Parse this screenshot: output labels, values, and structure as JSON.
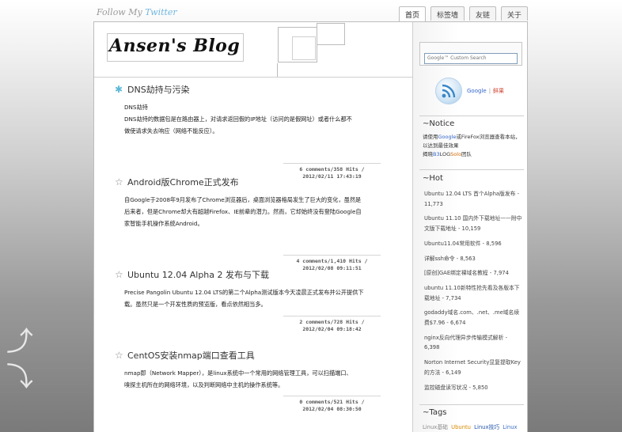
{
  "header": {
    "follow_text": "Follow My",
    "follow_twitter": "Twitter",
    "tabs": [
      "首页",
      "标签墙",
      "友链",
      "关于"
    ]
  },
  "blog": {
    "title": "Ansen's Blog"
  },
  "posts": [
    {
      "title": "DNS劫持与污染",
      "body_lines": [
        "DNS劫持",
        "DNS劫持的数据包是在路由器上，对请求返回假的IP地址（访问的是假网址）或者什么都不",
        "做使请求失去响应（网络不能反应）。"
      ],
      "meta_line1": "6 comments/358 Hits /",
      "meta_line2": "2012/02/11 17:43:19"
    },
    {
      "title": "Android版Chrome正式发布",
      "body_lines": [
        "自Google于2008年9月发布了Chrome浏览器后，桌面浏览器格局发生了巨大的变化，虽然是",
        "后来者，但是Chrome却大有超越Firefox、IE前辈的潜力。然而，它却始终没有登陆Google自",
        "家智能手机操作系统Android。"
      ],
      "meta_line1": "4 comments/1,410 Hits /",
      "meta_line2": "2012/02/08 09:11:51"
    },
    {
      "title": "Ubuntu 12.04 Alpha 2 发布与下载",
      "body_lines": [
        "Precise Pangolin Ubuntu 12.04 LTS的第二个Alpha测试版本今天凌晨正式发布并公开提供下",
        "载。虽然只是一个开发性质的预览版，看点依然相当多。"
      ],
      "meta_line1": "2 comments/728 Hits /",
      "meta_line2": "2012/02/04 09:18:42"
    },
    {
      "title": "CentOS安装nmap端口查看工具",
      "body_lines": [
        "nmap即（Network Mapper），是linux系统中一个常用的网络管理工具，可以扫描端口、",
        "嗅探主机所在的网络环境，以及判断网络中主机的操作系统等。"
      ],
      "meta_line1": "0 comments/521 Hits /",
      "meta_line2": "2012/02/04 08:30:50"
    }
  ],
  "sidebar": {
    "search_placeholder": "Google™ Custom Search",
    "rss_google": "Google",
    "rss_sep": "|",
    "rss_xianguo": "鲜果",
    "notice_title": "~Notice",
    "notice_pre": "请使用",
    "notice_google": "Google",
    "notice_or": "或",
    "notice_firefox": "FireFox",
    "notice_post": "浏览器查看本站，以达到最佳效果",
    "notice_credit_pre": "揭晓",
    "notice_credit_b3": "B3",
    "notice_credit_log": "LOG",
    "notice_credit_solo": "Solo",
    "notice_credit_post": "团队",
    "hot_title": "~Hot",
    "hot_items": [
      "Ubuntu 12.04 LTS 首个Alpha版发布 - 11,773",
      "Ubuntu 11.10 国内外下载地址——附中文版下载地址 - 10,159",
      "Ubuntu11.04常用软件 - 8,596",
      "详解ssh命令 - 8,563",
      "[原创]GAE绑定裸域名教程 - 7,974",
      "ubuntu 11.10新特性抢先看及各版本下载地址 - 7,734",
      "godaddy域名.com、.net、.me域名续费$7.96 - 6,674",
      "nginx反向代理异步传输模式解析 - 6,398",
      "Norton Internet Security显复提取Key的方法 - 6,149",
      "监控磁盘读写状况 - 5,850"
    ],
    "tags_title": "~Tags",
    "tags": [
      {
        "label": "Linux基础",
        "color": "#8a8a8a"
      },
      {
        "label": "Ubuntu",
        "color": "#d78a00"
      },
      {
        "label": "Linux技巧",
        "color": "#2255aa"
      },
      {
        "label": "Linux",
        "color": "#3a6fc4"
      }
    ]
  }
}
